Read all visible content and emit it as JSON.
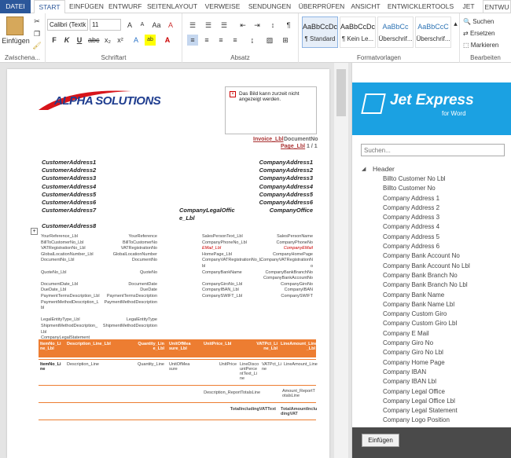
{
  "tabs": [
    "DATEI",
    "START",
    "EINFÜGEN",
    "ENTWURF",
    "SEITENLAYOUT",
    "VERWEISE",
    "SENDUNGEN",
    "ÜBERPRÜFEN",
    "ANSICHT",
    "ENTWICKLERTOOLS",
    "JET",
    "ENTWU"
  ],
  "ribbon": {
    "paste": "Einfügen",
    "clipboard": "Zwischena...",
    "font_name": "Calibri (Textk",
    "font_size": "11",
    "font_label": "Schriftart",
    "para_label": "Absatz",
    "styles_label": "Formatvorlagen",
    "edit_label": "Bearbeiten",
    "find": "Suchen",
    "replace": "Ersetzen",
    "select": "Markieren",
    "styles": [
      {
        "prev": "AaBbCcDc",
        "name": "¶ Standard"
      },
      {
        "prev": "AaBbCcDc",
        "name": "¶ Kein Le..."
      },
      {
        "prev": "AaBbCc",
        "name": "Überschrif..."
      },
      {
        "prev": "AaBbCcC",
        "name": "Überschrif..."
      }
    ]
  },
  "doc": {
    "logo": "ALPHA SOLUTIONS",
    "img_err": "Das Bild kann zurzeit nicht angezeigt werden.",
    "invoice": "Invoice_Lbl",
    "docno": "DocumentNo",
    "page": "Page_Lbl",
    "page_of": "1 / 1",
    "cust": [
      "CustomerAddress1",
      "CustomerAddress2",
      "CustomerAddress3",
      "CustomerAddress4",
      "CustomerAddress5",
      "CustomerAddress6",
      "CustomerAddress7",
      "CustomerAddress8"
    ],
    "comp": [
      "CompanyAddress1",
      "CompanyAddress2",
      "CompanyAddress3",
      "CompanyAddress4",
      "CompanyAddress5",
      "CompanyAddress6",
      "CompanyOffice"
    ],
    "legal": "CompanyLegalOffic",
    "legal2": "e_Lbl",
    "left_lbl": [
      "YourReference_Lbl",
      "BillToCustomerNo_Lbl",
      "VATRegistrationNo_Lbl",
      "GlobalLocationNumber_Lbl",
      "DocumentNo_Lbl",
      "",
      "QuoteNo_Lbl",
      "",
      "DocumentDate_Lbl",
      "DueDate_Lbl",
      "PaymentTermsDescription_Lbl",
      "PaymentMethodDescription_L",
      "bl",
      "",
      "LegalEntityType_Lbl",
      "ShipmentMethodDescription_",
      "Lbl",
      "CompanyLegalStatement"
    ],
    "left_val": [
      "YourReference",
      "BillToCustomerNo",
      "VATRegistrationNo",
      "GlobalLocationNumber",
      "DocumentNo",
      "",
      "QuoteNo",
      "",
      "DocumentDate",
      "DueDate",
      "PaymentTermsDescription",
      "PaymentMethodDescription",
      "",
      "",
      "LegalEntityType",
      "ShipmentMethodDescription"
    ],
    "mid_lbl": [
      "SalesPersonText_Lbl",
      "CompanyPhoneNo_Lbl",
      "EMail_Lbl",
      "HomePage_Lbl",
      "CompanyVATRegistrationNo_L",
      "bl",
      "CompanyBankName",
      "",
      "CompanyGiroNo_Lbl",
      "CompanyIBAN_Lbl",
      "CompanySWIFT_Lbl"
    ],
    "mid_val": [
      "SalesPersonName",
      "CompanyPhoneNo",
      "CompanyEMail",
      "CompanyHomePage",
      "CompanyVATRegistrationN",
      "o",
      "CompanyBankBranchNo",
      "CompanyBankAccountNo",
      "CompanyGiroNo",
      "CompanyIBAN",
      "CompanySWIFT"
    ],
    "th": [
      "ItemNo_Li ne_Lbl",
      "Description_Line_Lbl",
      "Quantity_Lin e_Lbl",
      "UnitOfMea sure_Lbl",
      "UnitPrice_Lbl",
      "VATPct_Li ne_Lbl",
      "LineAmount_Line _Lbl"
    ],
    "tr": [
      "ItemNo_Li ne",
      "Description_Line",
      "Quantity_Line",
      "UnitOfMea sure",
      "UnitPrice",
      "LineDisco untPerce ntText_Li ne",
      "VATPct_Li ne",
      "LineAmount_Line"
    ],
    "totals1": "Description_ReportTotalsLine",
    "totals2": "Amount_ReportT otalsLine",
    "totals3": "TotalIncludingVATText",
    "totals4": "TotalAmountInclu dingVAT"
  },
  "pane": {
    "brand": "Jet Express",
    "sub": "for Word",
    "search_placeholder": "Suchen...",
    "root": "Header",
    "items": [
      "Billto Customer No Lbl",
      "Billto Customer No",
      "Company Address 1",
      "Company Address 2",
      "Company Address 3",
      "Company Address 4",
      "Company Address 5",
      "Company Address 6",
      "Company Bank Account No",
      "Company Bank Account No Lbl",
      "Company Bank Branch No",
      "Company Bank Branch No Lbl",
      "Company Bank Name",
      "Company Bank Name Lbl",
      "Company Custom Giro",
      "Company Custom Giro Lbl",
      "Company E Mail",
      "Company Giro No",
      "Company Giro No Lbl",
      "Company Home Page",
      "Company IBAN",
      "Company IBAN Lbl",
      "Company Legal Office",
      "Company Legal Office Lbl",
      "Company Legal Statement",
      "Company Logo Position"
    ],
    "insert": "Einfügen"
  },
  "colors": {
    "accent": "#2b579a",
    "orange": "#ed7d31",
    "jet": "#1ba1e2"
  }
}
